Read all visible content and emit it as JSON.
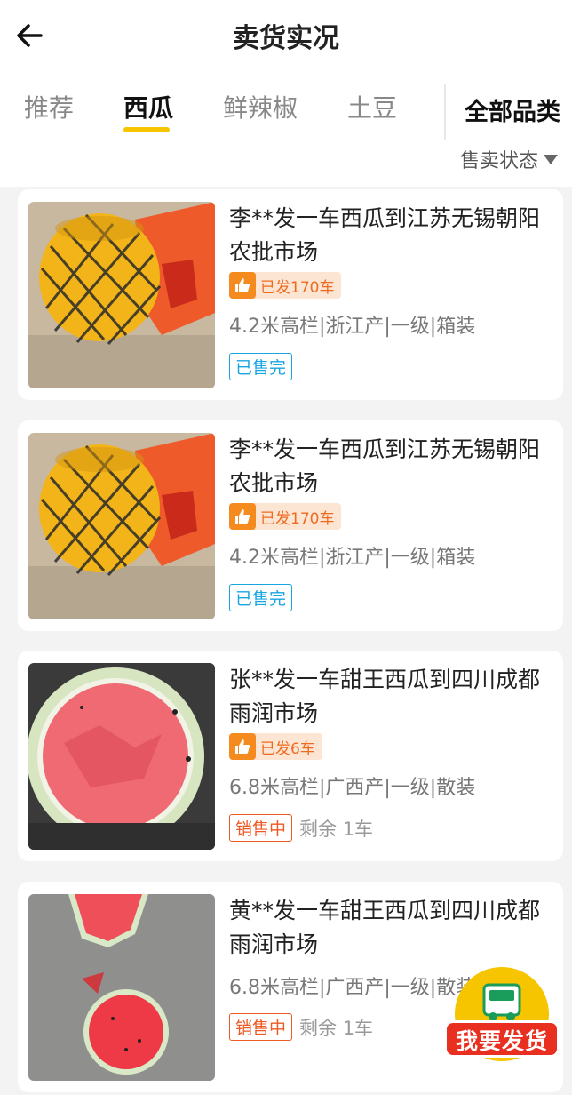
{
  "header": {
    "title": "卖货实况",
    "back_icon": "arrow-left-icon"
  },
  "tabs": [
    {
      "label": "推荐",
      "active": false
    },
    {
      "label": "西瓜",
      "active": true
    },
    {
      "label": "鲜辣椒",
      "active": false
    },
    {
      "label": "土豆",
      "active": false
    }
  ],
  "filters": {
    "all_categories": "全部品类",
    "sale_status": "售卖状态"
  },
  "colors": {
    "accent": "#f7c400",
    "sold": "#18a6e0",
    "selling": "#ee5a24",
    "badge_text": "#ee6a1f"
  },
  "listings": [
    {
      "title": "李**发一车西瓜到江苏无锡朝阳农批市场",
      "badge": "已发170车",
      "specs": "4.2米高栏|浙江产|一级|箱装",
      "status": "已售完",
      "remaining": "",
      "image": "netted-yellow-melon"
    },
    {
      "title": "李**发一车西瓜到江苏无锡朝阳农批市场",
      "badge": "已发170车",
      "specs": "4.2米高栏|浙江产|一级|箱装",
      "status": "已售完",
      "remaining": "",
      "image": "netted-yellow-melon"
    },
    {
      "title": "张**发一车甜王西瓜到四川成都雨润市场",
      "badge": "已发6车",
      "specs": "6.8米高栏|广西产|一级|散装",
      "status": "销售中",
      "remaining": "剩余 1车",
      "image": "cut-watermelon"
    },
    {
      "title": "黄**发一车甜王西瓜到四川成都雨润市场",
      "badge": "",
      "specs": "6.8米高栏|广西产|一级|散装",
      "status": "销售中",
      "remaining": "剩余 1车",
      "image": "watermelon-slices-on-ground"
    }
  ],
  "fab": {
    "label": "我要发货",
    "icon": "truck-icon"
  }
}
